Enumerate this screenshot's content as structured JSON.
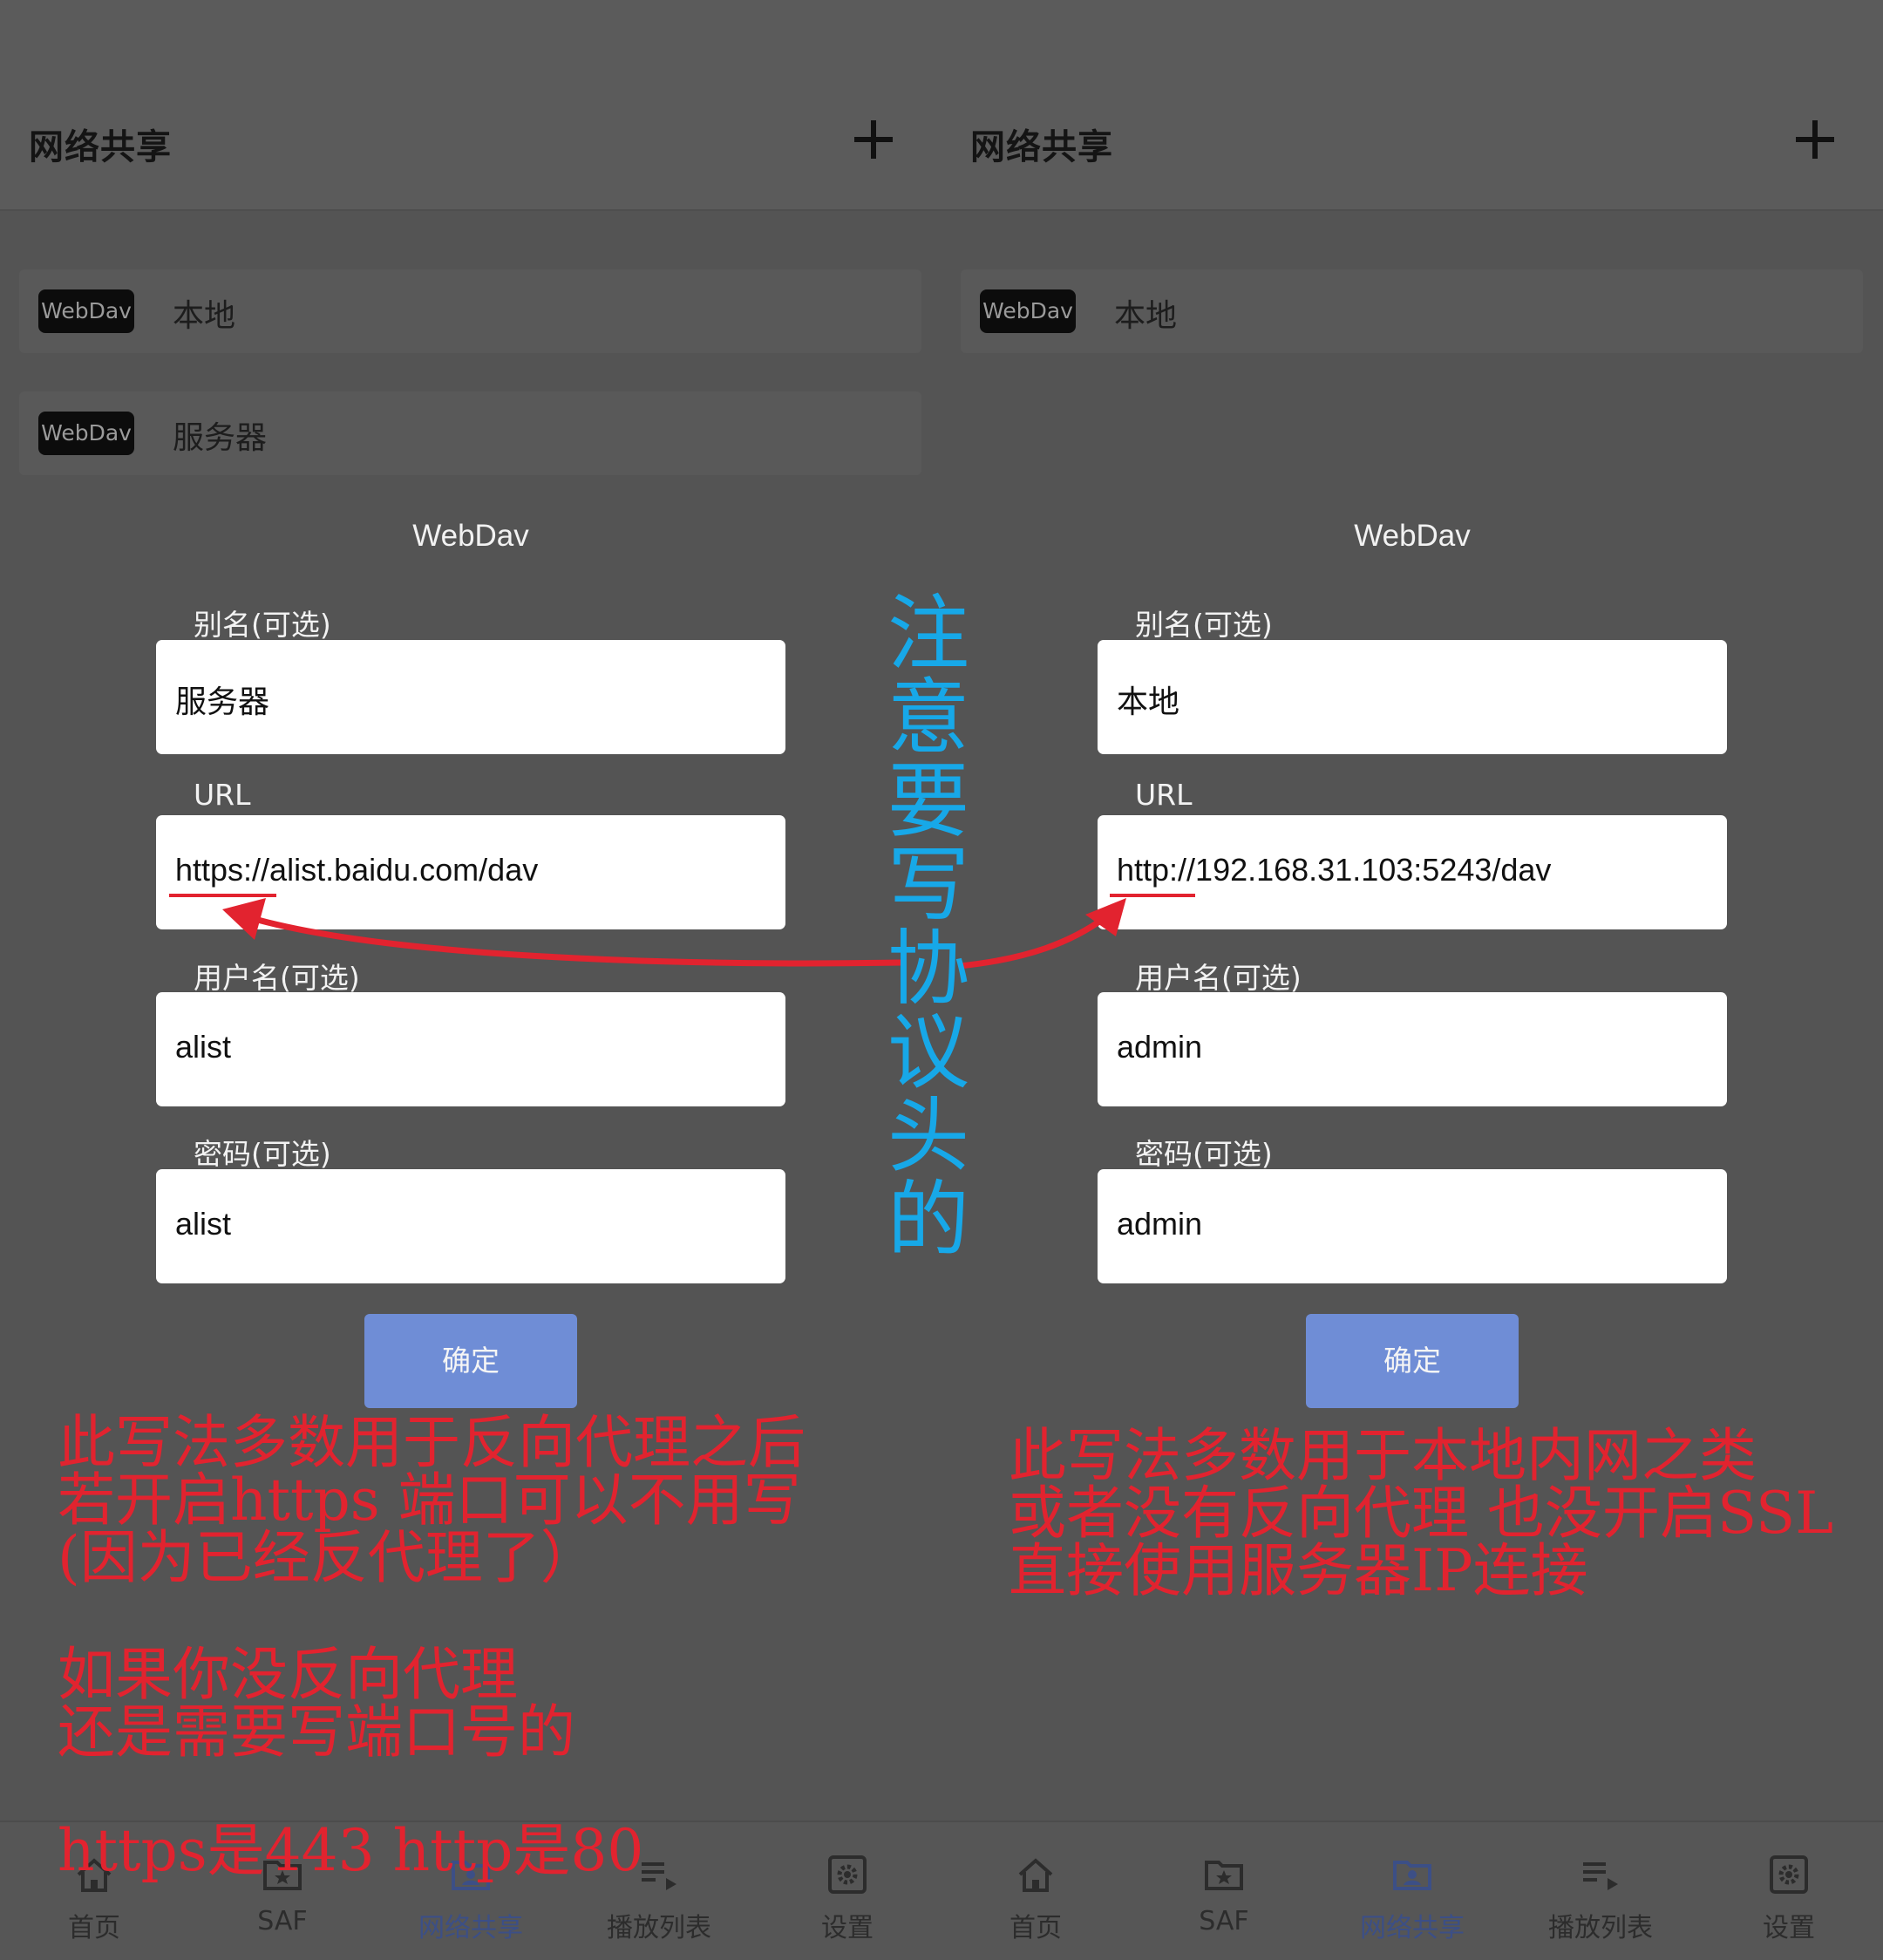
{
  "app_title": "网络共享",
  "tag_label": "WebDav",
  "left": {
    "items": [
      {
        "name": "本地"
      },
      {
        "name": "服务器"
      }
    ],
    "dialog": {
      "title": "WebDav",
      "alias_label": "别名(可选)",
      "alias_value": "服务器",
      "url_label": "URL",
      "url_value": "https://alist.baidu.com/dav",
      "user_label": "用户名(可选)",
      "user_value": "alist",
      "pass_label": "密码(可选)",
      "pass_value": "alist",
      "ok_label": "确定"
    }
  },
  "right": {
    "items": [
      {
        "name": "本地"
      }
    ],
    "dialog": {
      "title": "WebDav",
      "alias_label": "别名(可选)",
      "alias_value": "本地",
      "url_label": "URL",
      "url_value": "http://192.168.31.103:5243/dav",
      "user_label": "用户名(可选)",
      "user_value": "admin",
      "pass_label": "密码(可选)",
      "pass_value": "admin",
      "ok_label": "确定"
    }
  },
  "nav": {
    "home": "首页",
    "saf": "SAF",
    "share": "网络共享",
    "playlist": "播放列表",
    "settings": "设置",
    "active": "网络共享"
  },
  "annotations": {
    "vertical": "注意要写协议头的",
    "left_lines": [
      "此写法多数用于反向代理之后",
      "若开启https 端口可以不用写",
      "(因为已经反代理了）",
      "如果你没反向代理",
      "还是需要写端口号的",
      "https是443   http是80"
    ],
    "right_lines": [
      "此写法多数用于本地内网之类",
      "或者没有反向代理  也没开启SSL",
      "直接使用服务器IP连接"
    ]
  },
  "colors": {
    "annotation_red": "#e2232f",
    "annotation_blue": "#17a8e8",
    "button_blue": "#6f8dd6",
    "nav_active": "#3c4f86"
  }
}
